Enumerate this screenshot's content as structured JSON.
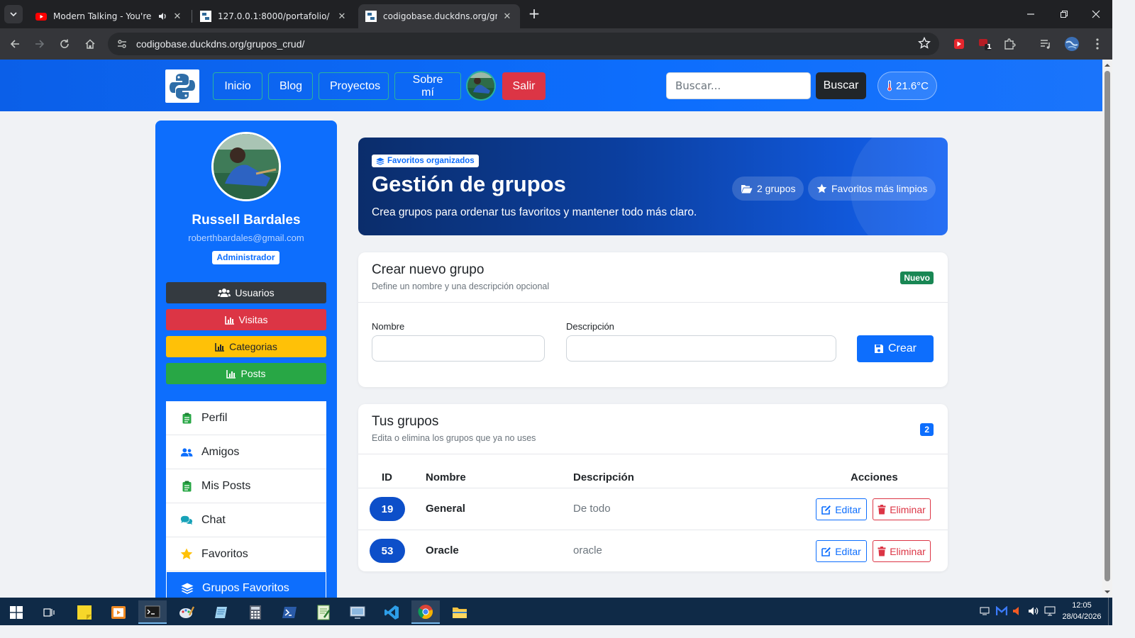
{
  "browser": {
    "tabs": [
      {
        "title": "Modern Talking - You're My",
        "favicon": "youtube-icon",
        "audio": true
      },
      {
        "title": "127.0.0.1:8000/portafolio/",
        "favicon": "python-icon"
      },
      {
        "title": "codigobase.duckdns.org/grupo",
        "favicon": "python-icon",
        "active": true
      }
    ],
    "url": "codigobase.duckdns.org/grupos_crud/",
    "extension_badge": "1"
  },
  "nav": {
    "links": [
      "Inicio",
      "Blog",
      "Proyectos",
      "Sobre mí"
    ],
    "logout": "Salir",
    "search_placeholder": "Buscar...",
    "search_button": "Buscar",
    "temperature": "21.6°C"
  },
  "sidebar": {
    "name": "Russell Bardales",
    "email": "roberthbardales@gmail.com",
    "role": "Administrador",
    "admin_buttons": [
      {
        "label": "Usuarios",
        "color": "#343a40",
        "icon": "users-icon"
      },
      {
        "label": "Visitas",
        "color": "#dc3545",
        "icon": "chart-icon"
      },
      {
        "label": "Categorias",
        "color": "#ffc107",
        "icon": "chart-icon"
      },
      {
        "label": "Posts",
        "color": "#28a745",
        "icon": "chart-icon"
      }
    ],
    "menu": [
      {
        "label": "Perfil",
        "icon": "clipboard-icon"
      },
      {
        "label": "Amigos",
        "icon": "users-icon"
      },
      {
        "label": "Mis Posts",
        "icon": "clipboard-icon"
      },
      {
        "label": "Chat",
        "icon": "comments-icon"
      },
      {
        "label": "Favoritos",
        "icon": "star-icon"
      },
      {
        "label": "Grupos Favoritos",
        "icon": "layers-icon",
        "active": true
      }
    ]
  },
  "hero": {
    "badge": "Favoritos organizados",
    "title": "Gestión de grupos",
    "subtitle": "Crea grupos para ordenar tus favoritos y mantener todo más claro.",
    "pill_groups": "2 grupos",
    "pill_clean": "Favoritos más limpios"
  },
  "create": {
    "title": "Crear nuevo grupo",
    "subtitle": "Define un nombre y una descripción opcional",
    "badge": "Nuevo",
    "name_label": "Nombre",
    "desc_label": "Descripción",
    "name_value": "",
    "desc_value": "",
    "button": "Crear"
  },
  "groups": {
    "title": "Tus grupos",
    "subtitle": "Edita o elimina los grupos que ya no uses",
    "count": "2",
    "columns": [
      "ID",
      "Nombre",
      "Descripción",
      "Acciones"
    ],
    "rows": [
      {
        "id": "19",
        "name": "General",
        "description": "De todo"
      },
      {
        "id": "53",
        "name": "Oracle",
        "description": "oracle"
      }
    ],
    "edit_label": "Editar",
    "delete_label": "Eliminar"
  },
  "taskbar": {
    "time": "12:05",
    "date": "28/04/2026"
  }
}
